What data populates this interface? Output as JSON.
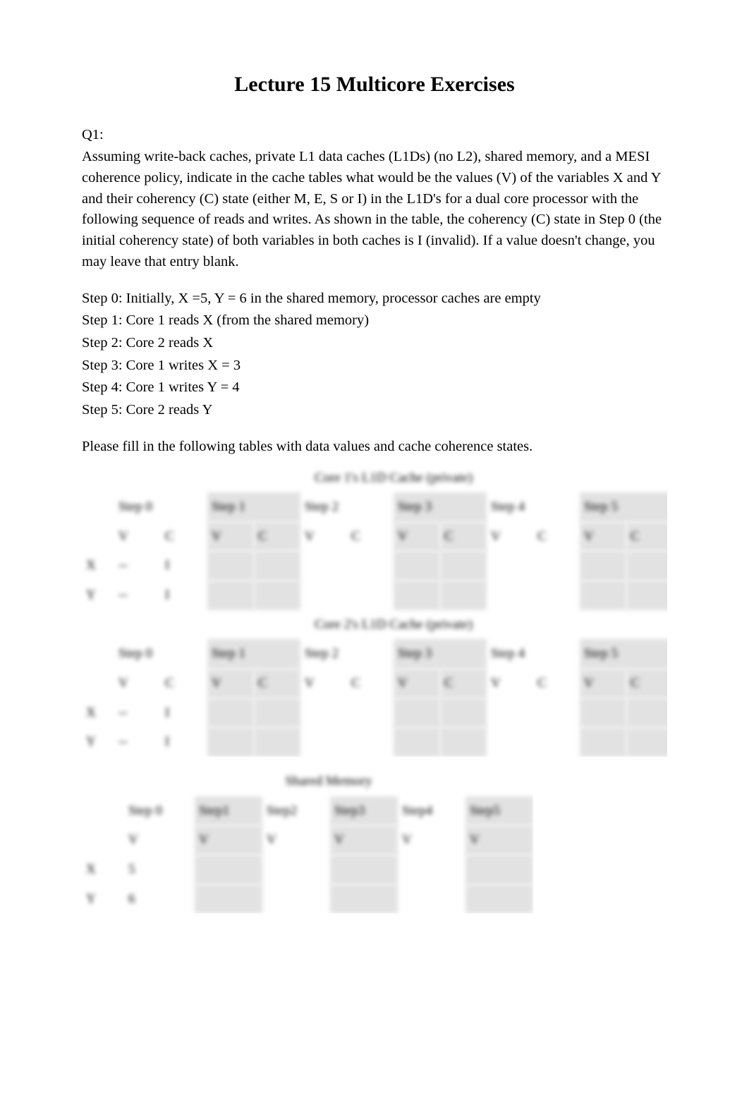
{
  "title": "Lecture 15 Multicore Exercises",
  "q_label": "Q1:",
  "intro": "Assuming write-back caches, private L1 data caches (L1Ds) (no L2), shared memory, and a MESI coherence policy, indicate in the cache tables what would be the values (V) of the variables X and Y and their coherency (C) state (either M, E, S or I) in the L1D's for a dual core processor with the following sequence of reads and writes. As shown in the table, the coherency (C) state in Step 0 (the initial coherency state) of both variables in both caches is I (invalid). If a value doesn't change, you may leave that entry blank.",
  "steps": {
    "s0": "Step 0: Initially, X =5, Y = 6 in the shared memory, processor caches are empty",
    "s1": "Step 1: Core 1 reads X (from the shared memory)",
    "s2": "Step 2: Core 2 reads X",
    "s3": "Step 3: Core 1 writes X = 3",
    "s4": "Step 4: Core 1 writes Y = 4",
    "s5": "Step 5: Core 2 reads Y"
  },
  "aftersteps": "Please fill in the following tables with data values and cache coherence states.",
  "cache_core1": {
    "caption": "Core 1's L1D Cache (private)",
    "step_labels": [
      "Step 0",
      "Step 1",
      "Step 2",
      "Step 3",
      "Step 4",
      "Step 5"
    ],
    "vc_labels": [
      "V",
      "C"
    ],
    "rows": [
      {
        "var": "X",
        "cells": [
          "--",
          "I",
          "",
          "",
          "",
          "",
          "",
          "",
          "",
          "",
          "",
          ""
        ]
      },
      {
        "var": "Y",
        "cells": [
          "--",
          "I",
          "",
          "",
          "",
          "",
          "",
          "",
          "",
          "",
          "",
          ""
        ]
      }
    ]
  },
  "cache_core2": {
    "caption": "Core 2's L1D Cache (private)",
    "step_labels": [
      "Step 0",
      "Step 1",
      "Step 2",
      "Step 3",
      "Step 4",
      "Step 5"
    ],
    "vc_labels": [
      "V",
      "C"
    ],
    "rows": [
      {
        "var": "X",
        "cells": [
          "--",
          "I",
          "",
          "",
          "",
          "",
          "",
          "",
          "",
          "",
          "",
          ""
        ]
      },
      {
        "var": "Y",
        "cells": [
          "--",
          "I",
          "",
          "",
          "",
          "",
          "",
          "",
          "",
          "",
          "",
          ""
        ]
      }
    ]
  },
  "shared_memory": {
    "caption": "Shared Memory",
    "step_labels": [
      "Step 0",
      "Step1",
      "Step2",
      "Step3",
      "Step4",
      "Step5"
    ],
    "v_label": "V",
    "rows": [
      {
        "var": "X",
        "cells": [
          "5",
          "",
          "",
          "",
          "",
          ""
        ]
      },
      {
        "var": "Y",
        "cells": [
          "6",
          "",
          "",
          "",
          "",
          ""
        ]
      }
    ]
  }
}
